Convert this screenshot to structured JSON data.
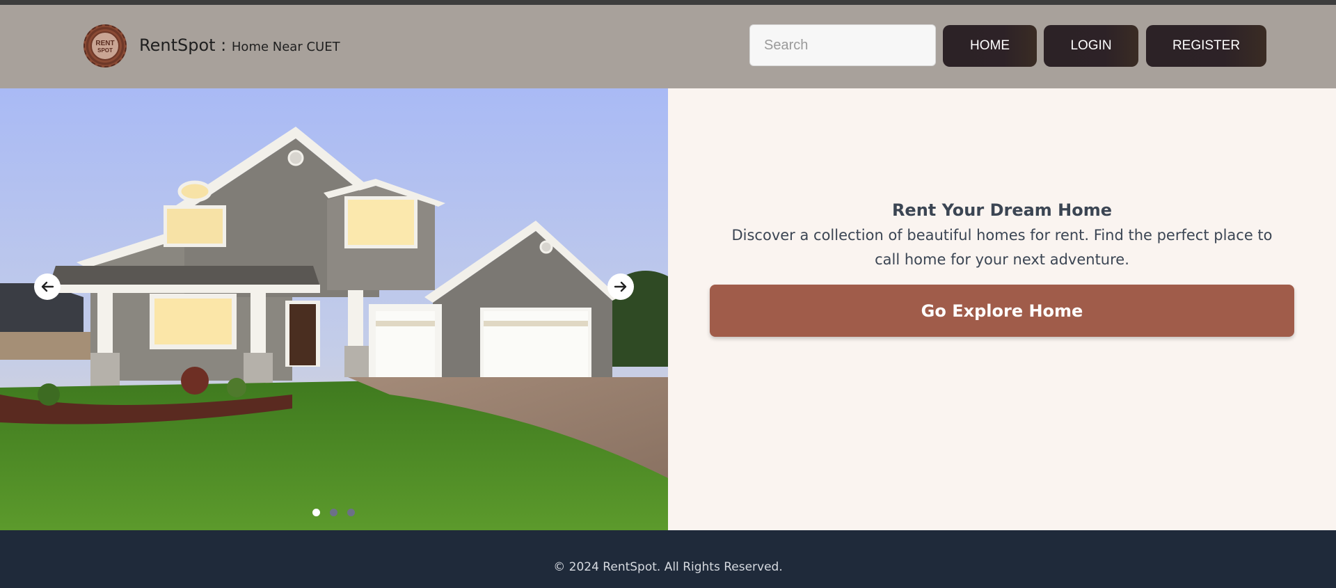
{
  "header": {
    "logo_text_top": "RENT",
    "logo_text_bottom": "SPOT",
    "brand_name": "RentSpot : ",
    "brand_tagline": "Home Near CUET"
  },
  "search": {
    "placeholder": "Search",
    "value": ""
  },
  "nav": {
    "home": "HOME",
    "login": "LOGIN",
    "register": "REGISTER"
  },
  "carousel": {
    "slide_count": 3,
    "active_slide": 1
  },
  "hero": {
    "title": "Rent Your Dream Home",
    "description": "Discover a collection of beautiful homes for rent. Find the perfect place to call home for your next adventure.",
    "cta_label": "Go Explore Home"
  },
  "footer": {
    "copyright": "© 2024 RentSpot. All Rights Reserved."
  },
  "colors": {
    "navbar": "#a8a19b",
    "nav_button": "#2c2226",
    "cta": "#a05c4a",
    "footer": "#1f2a3a",
    "hero_bg": "#faf4f0"
  }
}
